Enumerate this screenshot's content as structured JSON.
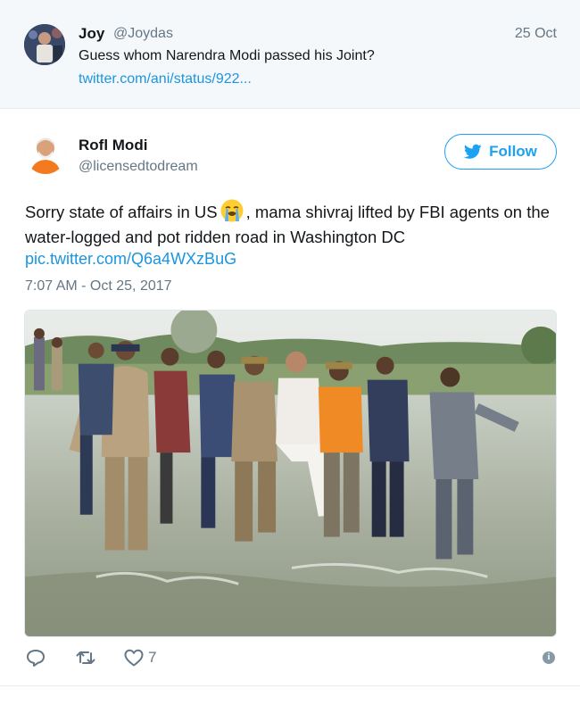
{
  "parent_tweet": {
    "name": "Joy",
    "handle": "@Joydas",
    "date": "25 Oct",
    "text": "Guess whom Narendra Modi passed his Joint?",
    "link": "twitter.com/ani/status/922..."
  },
  "tweet": {
    "name": "Rofl Modi",
    "handle": "@licensedtodream",
    "follow_label": "Follow",
    "text_before_emoji": "Sorry state of affairs in US",
    "emoji": "loudly-crying-face",
    "text_after_emoji": ", mama shivraj lifted by FBI agents on the water-logged and pot ridden road in Washington DC",
    "link": "pic.twitter.com/Q6a4WXzBuG",
    "timestamp": "7:07 AM - Oct 25, 2017",
    "like_count": "7"
  },
  "colors": {
    "accent": "#1da1f2",
    "link": "#1b95e0",
    "secondary_text": "#657786",
    "parent_bg": "#f5f8fa"
  },
  "icons": [
    "twitter-bird-icon",
    "reply-icon",
    "retweet-icon",
    "like-icon",
    "info-icon"
  ]
}
